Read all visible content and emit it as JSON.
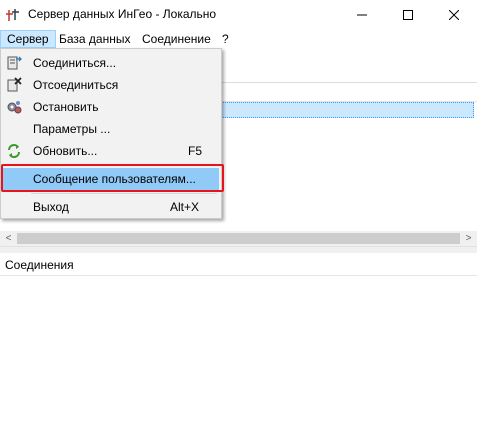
{
  "window": {
    "title": "Сервер данных ИнГео - Локально",
    "buttons": {
      "minimize": "—",
      "maximize": "☐",
      "close": "✕"
    }
  },
  "menubar": [
    {
      "label": "Сервер",
      "active": true
    },
    {
      "label": "База данных"
    },
    {
      "label": "Соединение"
    },
    {
      "label": "?"
    }
  ],
  "server_menu": {
    "items": [
      {
        "label": "Соединиться...",
        "icon": "connect-icon"
      },
      {
        "label": "Отсоединиться",
        "icon": "disconnect-icon"
      },
      {
        "label": "Остановить",
        "icon": "stop-server-icon"
      },
      {
        "label": "Параметры ..."
      },
      {
        "label": "Обновить...",
        "shortcut": "F5",
        "icon": "refresh-icon"
      },
      {
        "label": "Сообщение пользователям...",
        "highlighted": true
      },
      {
        "label": "Выход",
        "shortcut": "Alt+X"
      }
    ]
  },
  "scrollbar": {
    "left": "<",
    "right": ">"
  },
  "bottom_panel": {
    "title": "Соединения"
  },
  "colors": {
    "highlight": "#91c9f7",
    "menu_active": "#cce8ff",
    "annotation": "#e8141c"
  }
}
